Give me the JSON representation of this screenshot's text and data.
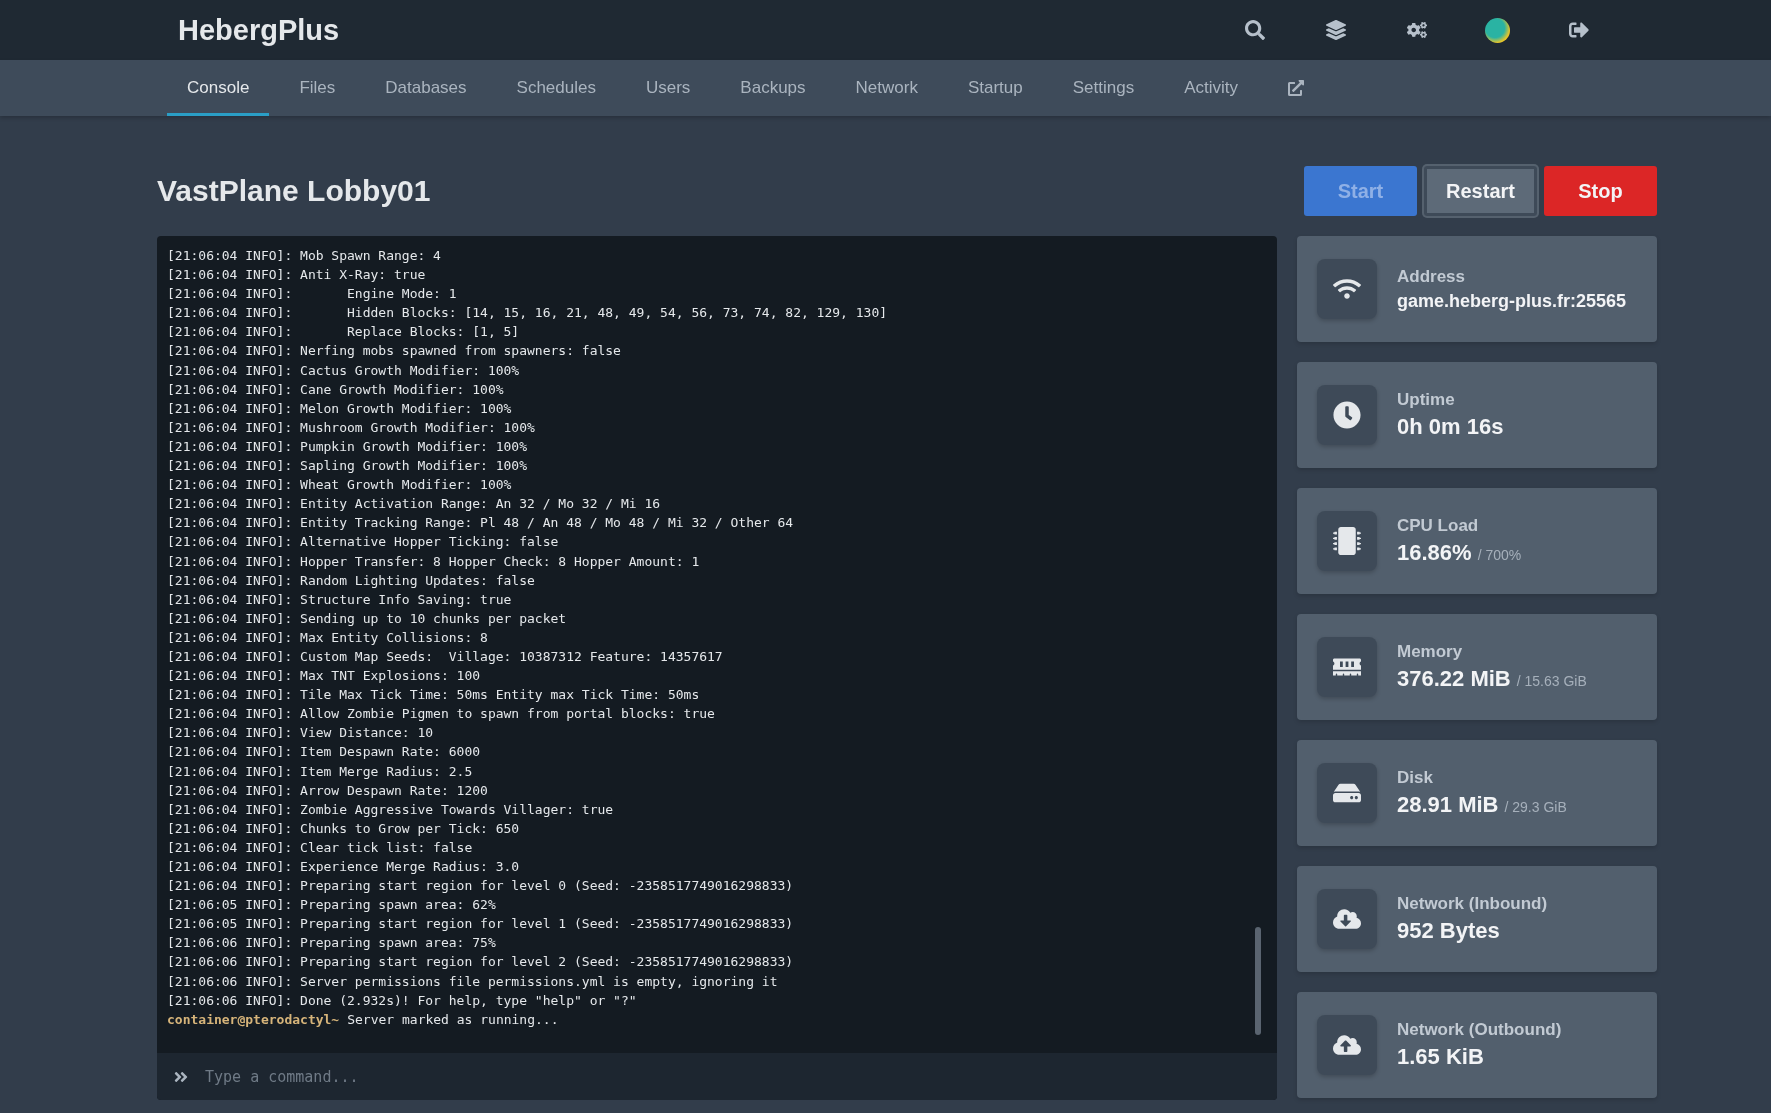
{
  "brand": "HebergPlus",
  "top_icons": [
    {
      "kind": "search"
    },
    {
      "kind": "layers"
    },
    {
      "kind": "cogs"
    },
    {
      "kind": "avatar"
    },
    {
      "kind": "logout"
    }
  ],
  "tabs": [
    {
      "label": "Console",
      "selected": true
    },
    {
      "label": "Files",
      "selected": false
    },
    {
      "label": "Databases",
      "selected": false
    },
    {
      "label": "Schedules",
      "selected": false
    },
    {
      "label": "Users",
      "selected": false
    },
    {
      "label": "Backups",
      "selected": false
    },
    {
      "label": "Network",
      "selected": false
    },
    {
      "label": "Startup",
      "selected": false
    },
    {
      "label": "Settings",
      "selected": false
    },
    {
      "label": "Activity",
      "selected": false
    }
  ],
  "server_title": "VastPlane Lobby01",
  "buttons": [
    {
      "label": "Start",
      "kind": "start",
      "disabled": true,
      "focused": false
    },
    {
      "label": "Restart",
      "kind": "restart",
      "disabled": false,
      "focused": true
    },
    {
      "label": "Stop",
      "kind": "stop",
      "disabled": false,
      "focused": false
    }
  ],
  "console": {
    "lines": [
      {
        "kind": "log",
        "text": "[21:06:04 INFO]: Mob Spawn Range: 4"
      },
      {
        "kind": "log",
        "text": "[21:06:04 INFO]: Anti X-Ray: true"
      },
      {
        "kind": "log",
        "text": "[21:06:04 INFO]:       Engine Mode: 1"
      },
      {
        "kind": "log",
        "text": "[21:06:04 INFO]:       Hidden Blocks: [14, 15, 16, 21, 48, 49, 54, 56, 73, 74, 82, 129, 130]"
      },
      {
        "kind": "log",
        "text": "[21:06:04 INFO]:       Replace Blocks: [1, 5]"
      },
      {
        "kind": "log",
        "text": "[21:06:04 INFO]: Nerfing mobs spawned from spawners: false"
      },
      {
        "kind": "log",
        "text": "[21:06:04 INFO]: Cactus Growth Modifier: 100%"
      },
      {
        "kind": "log",
        "text": "[21:06:04 INFO]: Cane Growth Modifier: 100%"
      },
      {
        "kind": "log",
        "text": "[21:06:04 INFO]: Melon Growth Modifier: 100%"
      },
      {
        "kind": "log",
        "text": "[21:06:04 INFO]: Mushroom Growth Modifier: 100%"
      },
      {
        "kind": "log",
        "text": "[21:06:04 INFO]: Pumpkin Growth Modifier: 100%"
      },
      {
        "kind": "log",
        "text": "[21:06:04 INFO]: Sapling Growth Modifier: 100%"
      },
      {
        "kind": "log",
        "text": "[21:06:04 INFO]: Wheat Growth Modifier: 100%"
      },
      {
        "kind": "log",
        "text": "[21:06:04 INFO]: Entity Activation Range: An 32 / Mo 32 / Mi 16"
      },
      {
        "kind": "log",
        "text": "[21:06:04 INFO]: Entity Tracking Range: Pl 48 / An 48 / Mo 48 / Mi 32 / Other 64"
      },
      {
        "kind": "log",
        "text": "[21:06:04 INFO]: Alternative Hopper Ticking: false"
      },
      {
        "kind": "log",
        "text": "[21:06:04 INFO]: Hopper Transfer: 8 Hopper Check: 8 Hopper Amount: 1"
      },
      {
        "kind": "log",
        "text": "[21:06:04 INFO]: Random Lighting Updates: false"
      },
      {
        "kind": "log",
        "text": "[21:06:04 INFO]: Structure Info Saving: true"
      },
      {
        "kind": "log",
        "text": "[21:06:04 INFO]: Sending up to 10 chunks per packet"
      },
      {
        "kind": "log",
        "text": "[21:06:04 INFO]: Max Entity Collisions: 8"
      },
      {
        "kind": "log",
        "text": "[21:06:04 INFO]: Custom Map Seeds:  Village: 10387312 Feature: 14357617"
      },
      {
        "kind": "log",
        "text": "[21:06:04 INFO]: Max TNT Explosions: 100"
      },
      {
        "kind": "log",
        "text": "[21:06:04 INFO]: Tile Max Tick Time: 50ms Entity max Tick Time: 50ms"
      },
      {
        "kind": "log",
        "text": "[21:06:04 INFO]: Allow Zombie Pigmen to spawn from portal blocks: true"
      },
      {
        "kind": "log",
        "text": "[21:06:04 INFO]: View Distance: 10"
      },
      {
        "kind": "log",
        "text": "[21:06:04 INFO]: Item Despawn Rate: 6000"
      },
      {
        "kind": "log",
        "text": "[21:06:04 INFO]: Item Merge Radius: 2.5"
      },
      {
        "kind": "log",
        "text": "[21:06:04 INFO]: Arrow Despawn Rate: 1200"
      },
      {
        "kind": "log",
        "text": "[21:06:04 INFO]: Zombie Aggressive Towards Villager: true"
      },
      {
        "kind": "log",
        "text": "[21:06:04 INFO]: Chunks to Grow per Tick: 650"
      },
      {
        "kind": "log",
        "text": "[21:06:04 INFO]: Clear tick list: false"
      },
      {
        "kind": "log",
        "text": "[21:06:04 INFO]: Experience Merge Radius: 3.0"
      },
      {
        "kind": "log",
        "text": "[21:06:04 INFO]: Preparing start region for level 0 (Seed: -2358517749016298833)"
      },
      {
        "kind": "log",
        "text": "[21:06:05 INFO]: Preparing spawn area: 62%"
      },
      {
        "kind": "log",
        "text": "[21:06:05 INFO]: Preparing start region for level 1 (Seed: -2358517749016298833)"
      },
      {
        "kind": "log",
        "text": "[21:06:06 INFO]: Preparing spawn area: 75%"
      },
      {
        "kind": "log",
        "text": "[21:06:06 INFO]: Preparing start region for level 2 (Seed: -2358517749016298833)"
      },
      {
        "kind": "log",
        "text": "[21:06:06 INFO]: Server permissions file permissions.yml is empty, ignoring it"
      },
      {
        "kind": "log",
        "text": "[21:06:06 INFO]: Done (2.932s)! For help, type \"help\" or \"?\""
      },
      {
        "kind": "prompt",
        "prompt": "container@pterodactyl~",
        "text": "Server marked as running..."
      }
    ],
    "command": {
      "placeholder": "Type a command..."
    }
  },
  "stats": [
    {
      "kind": "address",
      "label": "Address",
      "value": "game.heberg-plus.fr:25565"
    },
    {
      "kind": "uptime",
      "label": "Uptime",
      "value": "0h 0m 16s"
    },
    {
      "kind": "cpu",
      "label": "CPU Load",
      "value": "16.86%",
      "limit": "/ 700%"
    },
    {
      "kind": "memory",
      "label": "Memory",
      "value": "376.22 MiB",
      "limit": "/ 15.63 GiB"
    },
    {
      "kind": "disk",
      "label": "Disk",
      "value": "28.91 MiB",
      "limit": "/ 29.3 GiB"
    },
    {
      "kind": "inbound",
      "label": "Network (Inbound)",
      "value": "952 Bytes"
    },
    {
      "kind": "outbound",
      "label": "Network (Outbound)",
      "value": "1.65 KiB"
    }
  ]
}
